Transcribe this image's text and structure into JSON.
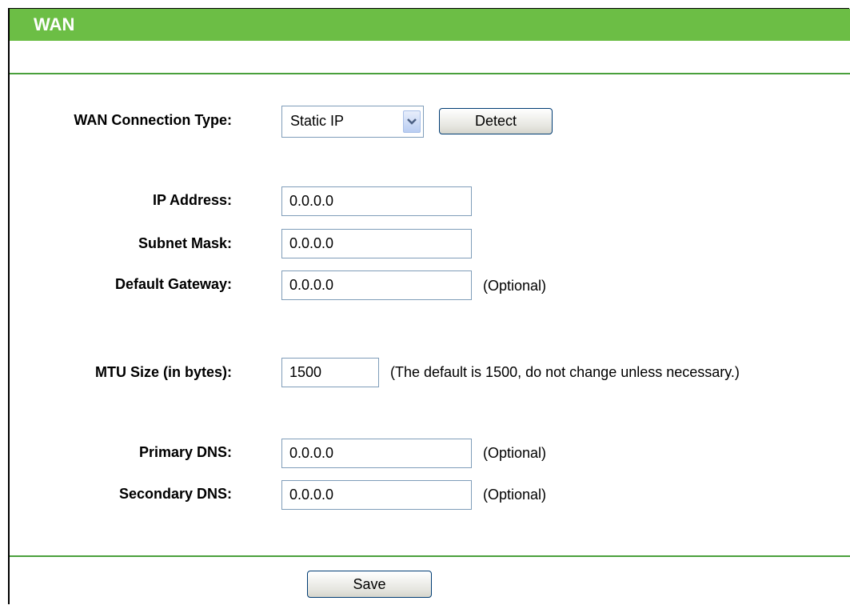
{
  "header": {
    "title": "WAN"
  },
  "connection": {
    "label": "WAN Connection Type:",
    "selected": "Static IP",
    "detect_label": "Detect"
  },
  "fields": {
    "ip": {
      "label": "IP Address:",
      "value": "0.0.0.0"
    },
    "subnet": {
      "label": "Subnet Mask:",
      "value": "0.0.0.0"
    },
    "gateway": {
      "label": "Default Gateway:",
      "value": "0.0.0.0",
      "note": "(Optional)"
    },
    "mtu": {
      "label": "MTU Size (in bytes):",
      "value": "1500",
      "note": "(The default is 1500, do not change unless necessary.)"
    },
    "dns1": {
      "label": "Primary DNS:",
      "value": "0.0.0.0",
      "note": "(Optional)"
    },
    "dns2": {
      "label": "Secondary DNS:",
      "value": "0.0.0.0",
      "note": "(Optional)"
    }
  },
  "footer": {
    "save_label": "Save"
  },
  "colors": {
    "header_green": "#6cbe45",
    "separator_green": "#4aa03c"
  }
}
